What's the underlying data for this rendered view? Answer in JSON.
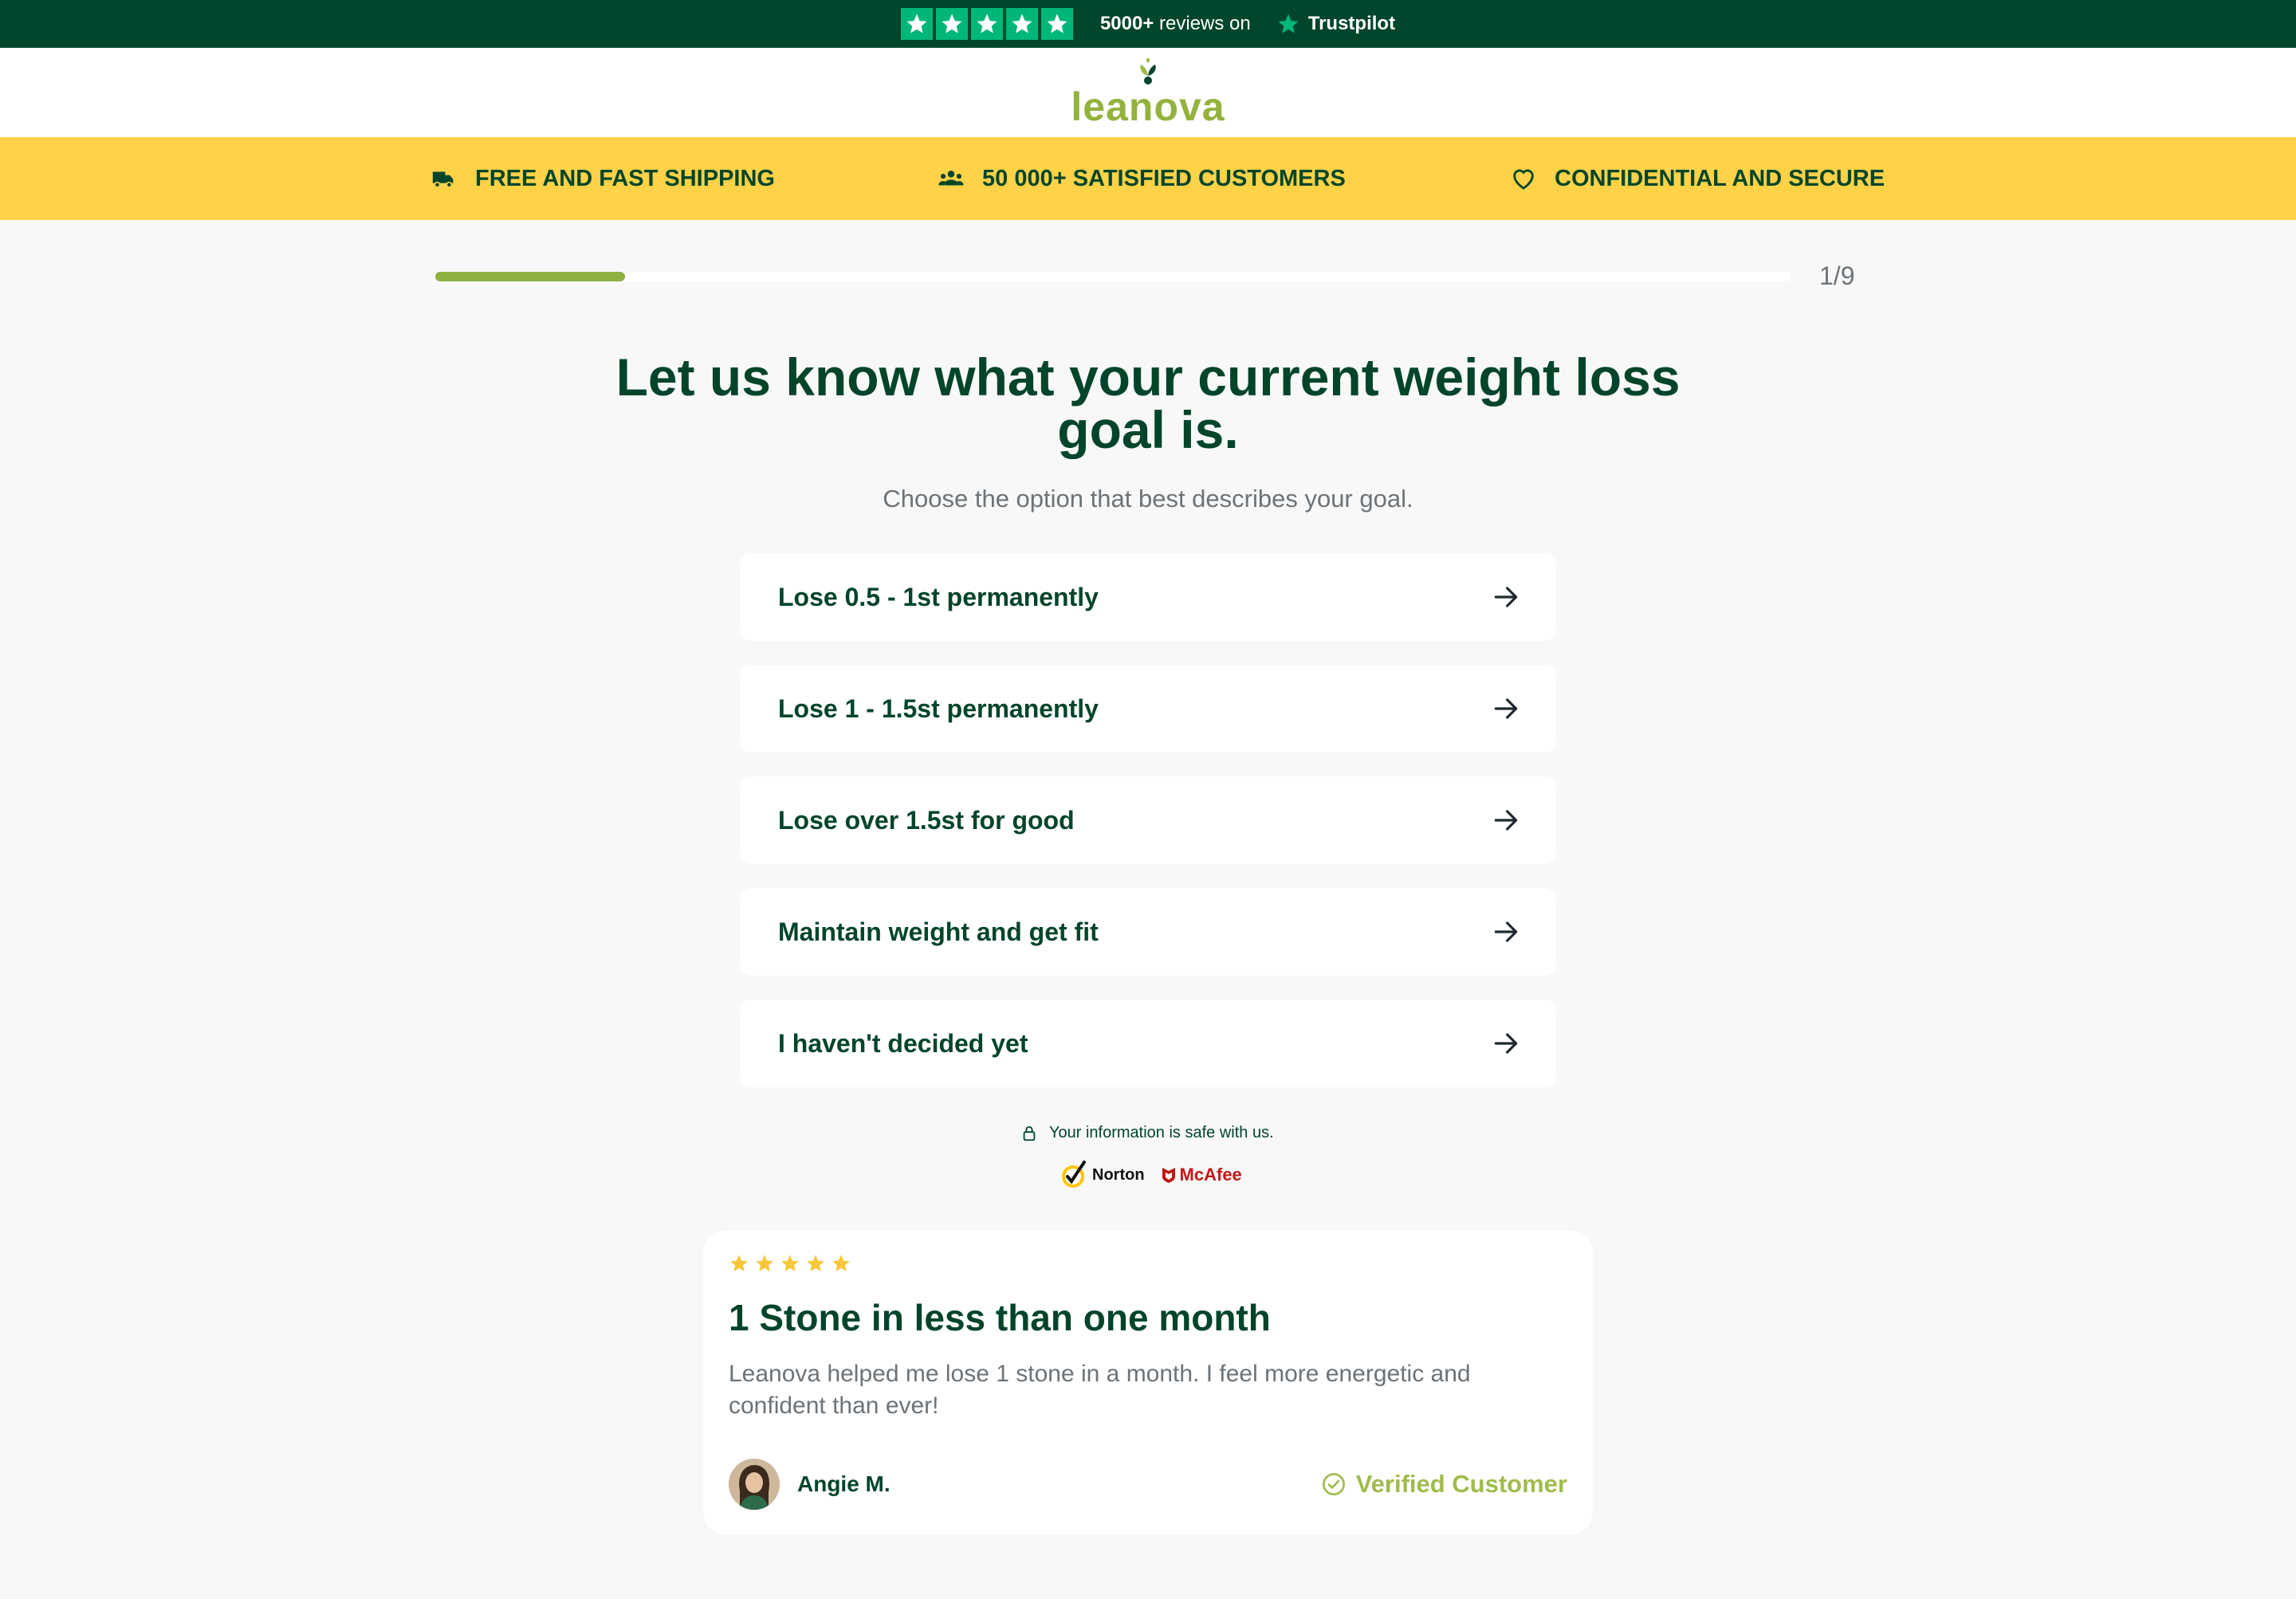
{
  "trustbar": {
    "reviews_count": "5000+",
    "reviews_text": "reviews on",
    "brand": "Trustpilot",
    "star_count": 5,
    "colors": {
      "background": "#00462c",
      "star": "#00b67a"
    }
  },
  "header": {
    "logo_text": "leanova",
    "logo_icon": "leaf-icon"
  },
  "usps": [
    {
      "icon": "truck-icon",
      "label": "FREE AND FAST SHIPPING"
    },
    {
      "icon": "users-icon",
      "label": "50 000+ SATISFIED CUSTOMERS"
    },
    {
      "icon": "heart-icon",
      "label": "CONFIDENTIAL AND SECURE"
    }
  ],
  "progress": {
    "step": 1,
    "total": 9,
    "label": "1/9",
    "fraction": 0.14
  },
  "question": {
    "title": "Let us know what your current weight loss goal is.",
    "subtitle": "Choose the option that best describes your goal."
  },
  "options": [
    {
      "label": "Lose 0.5 - 1st permanently"
    },
    {
      "label": "Lose 1 - 1.5st permanently"
    },
    {
      "label": "Lose over 1.5st for good"
    },
    {
      "label": "Maintain weight and get fit"
    },
    {
      "label": "I haven't decided yet"
    }
  ],
  "security": {
    "text": "Your information is safe with us.",
    "badge_norton": "Norton",
    "badge_mcafee": "McAfee"
  },
  "review": {
    "rating": 5,
    "title": "1 Stone in less than one month",
    "body": "Leanova helped me lose 1 stone in a month. I feel more energetic and confident than ever!",
    "author": "Angie M.",
    "verified_label": "Verified Customer"
  },
  "colors": {
    "brand_green": "#00452a",
    "accent_green": "#8fb13f",
    "usp_yellow": "#ffd248",
    "star_yellow": "#f7c73a",
    "verified_green": "#9fbc4c"
  }
}
